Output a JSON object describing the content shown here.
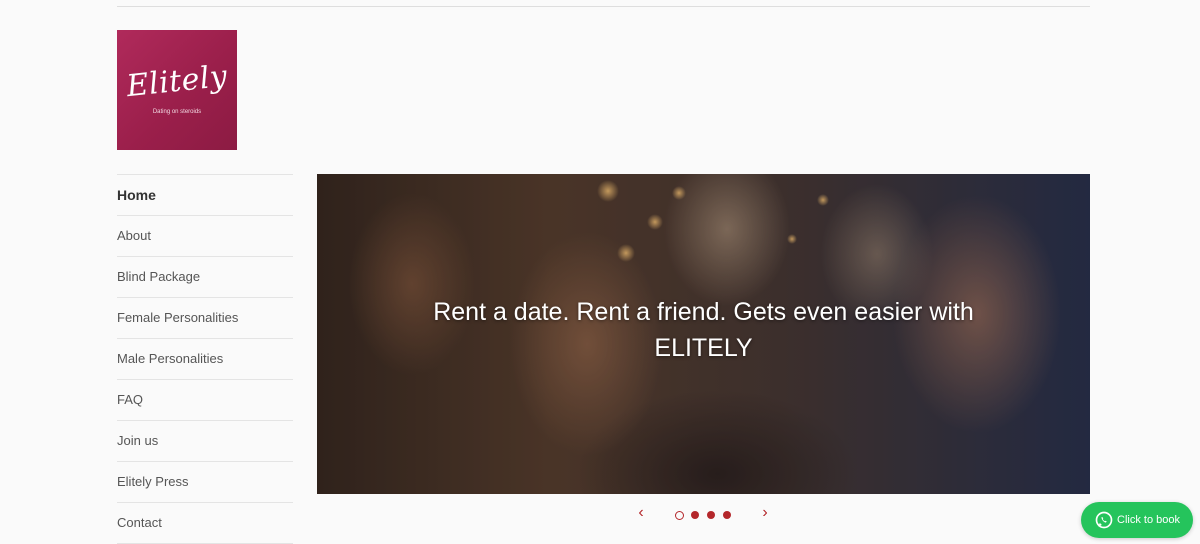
{
  "logo": {
    "name": "Elitely",
    "tagline": "Dating on steroids",
    "colors": {
      "background": "#a0224f"
    }
  },
  "nav": {
    "items": [
      {
        "label": "Home",
        "active": true
      },
      {
        "label": "About"
      },
      {
        "label": "Blind Package"
      },
      {
        "label": "Female Personalities"
      },
      {
        "label": "Male Personalities"
      },
      {
        "label": "FAQ"
      },
      {
        "label": "Join us"
      },
      {
        "label": "Elitely Press"
      },
      {
        "label": "Contact"
      }
    ]
  },
  "hero": {
    "caption": "Rent a date. Rent a friend. Gets even easier with ELITELY",
    "slide_count": 4,
    "current_slide": 1,
    "prev_icon": "chevron-left-icon",
    "next_icon": "chevron-right-icon",
    "prev_glyph": "‹",
    "next_glyph": "›"
  },
  "whatsapp": {
    "label": "Click to book",
    "icon": "whatsapp-icon",
    "color": "#25c45c"
  },
  "colors": {
    "accent": "#b4272b",
    "background": "#fafafa"
  }
}
